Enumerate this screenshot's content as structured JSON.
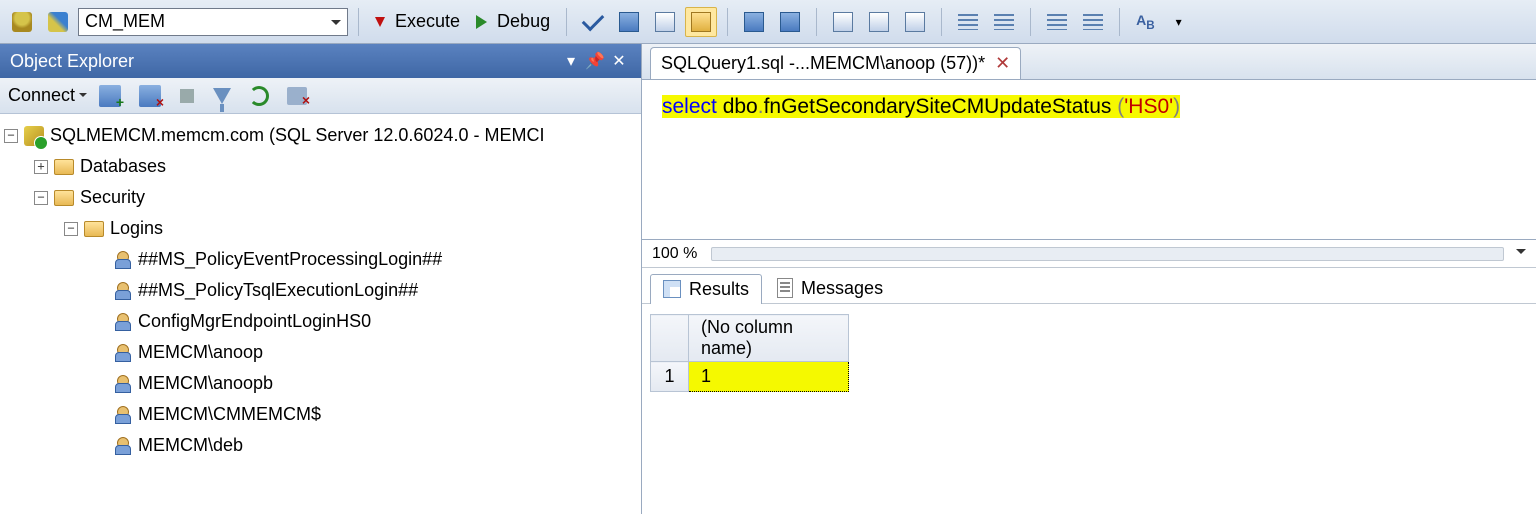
{
  "toolbar": {
    "database_selected": "CM_MEM",
    "execute_label": "Execute",
    "debug_label": "Debug"
  },
  "object_explorer": {
    "title": "Object Explorer",
    "connect_label": "Connect",
    "server_node": "SQLMEMCM.memcm.com (SQL Server 12.0.6024.0 - MEMCI",
    "databases_label": "Databases",
    "security_label": "Security",
    "logins_label": "Logins",
    "logins": [
      "##MS_PolicyEventProcessingLogin##",
      "##MS_PolicyTsqlExecutionLogin##",
      "ConfigMgrEndpointLoginHS0",
      "MEMCM\\anoop",
      "MEMCM\\anoopb",
      "MEMCM\\CMMEMCM$",
      "MEMCM\\deb"
    ]
  },
  "editor": {
    "tab_title": "SQLQuery1.sql -...MEMCM\\anoop (57))*",
    "sql_keyword": "select",
    "sql_mid": " dbo",
    "sql_dot1": ".",
    "sql_fn": "fnGetSecondarySiteCMUpdateStatus ",
    "sql_paren_open": "(",
    "sql_arg": "'HS0'",
    "sql_paren_close": ")",
    "zoom": "100 %"
  },
  "results": {
    "results_label": "Results",
    "messages_label": "Messages",
    "col_header": "(No column name)",
    "row_num": "1",
    "cell_value": "1"
  }
}
